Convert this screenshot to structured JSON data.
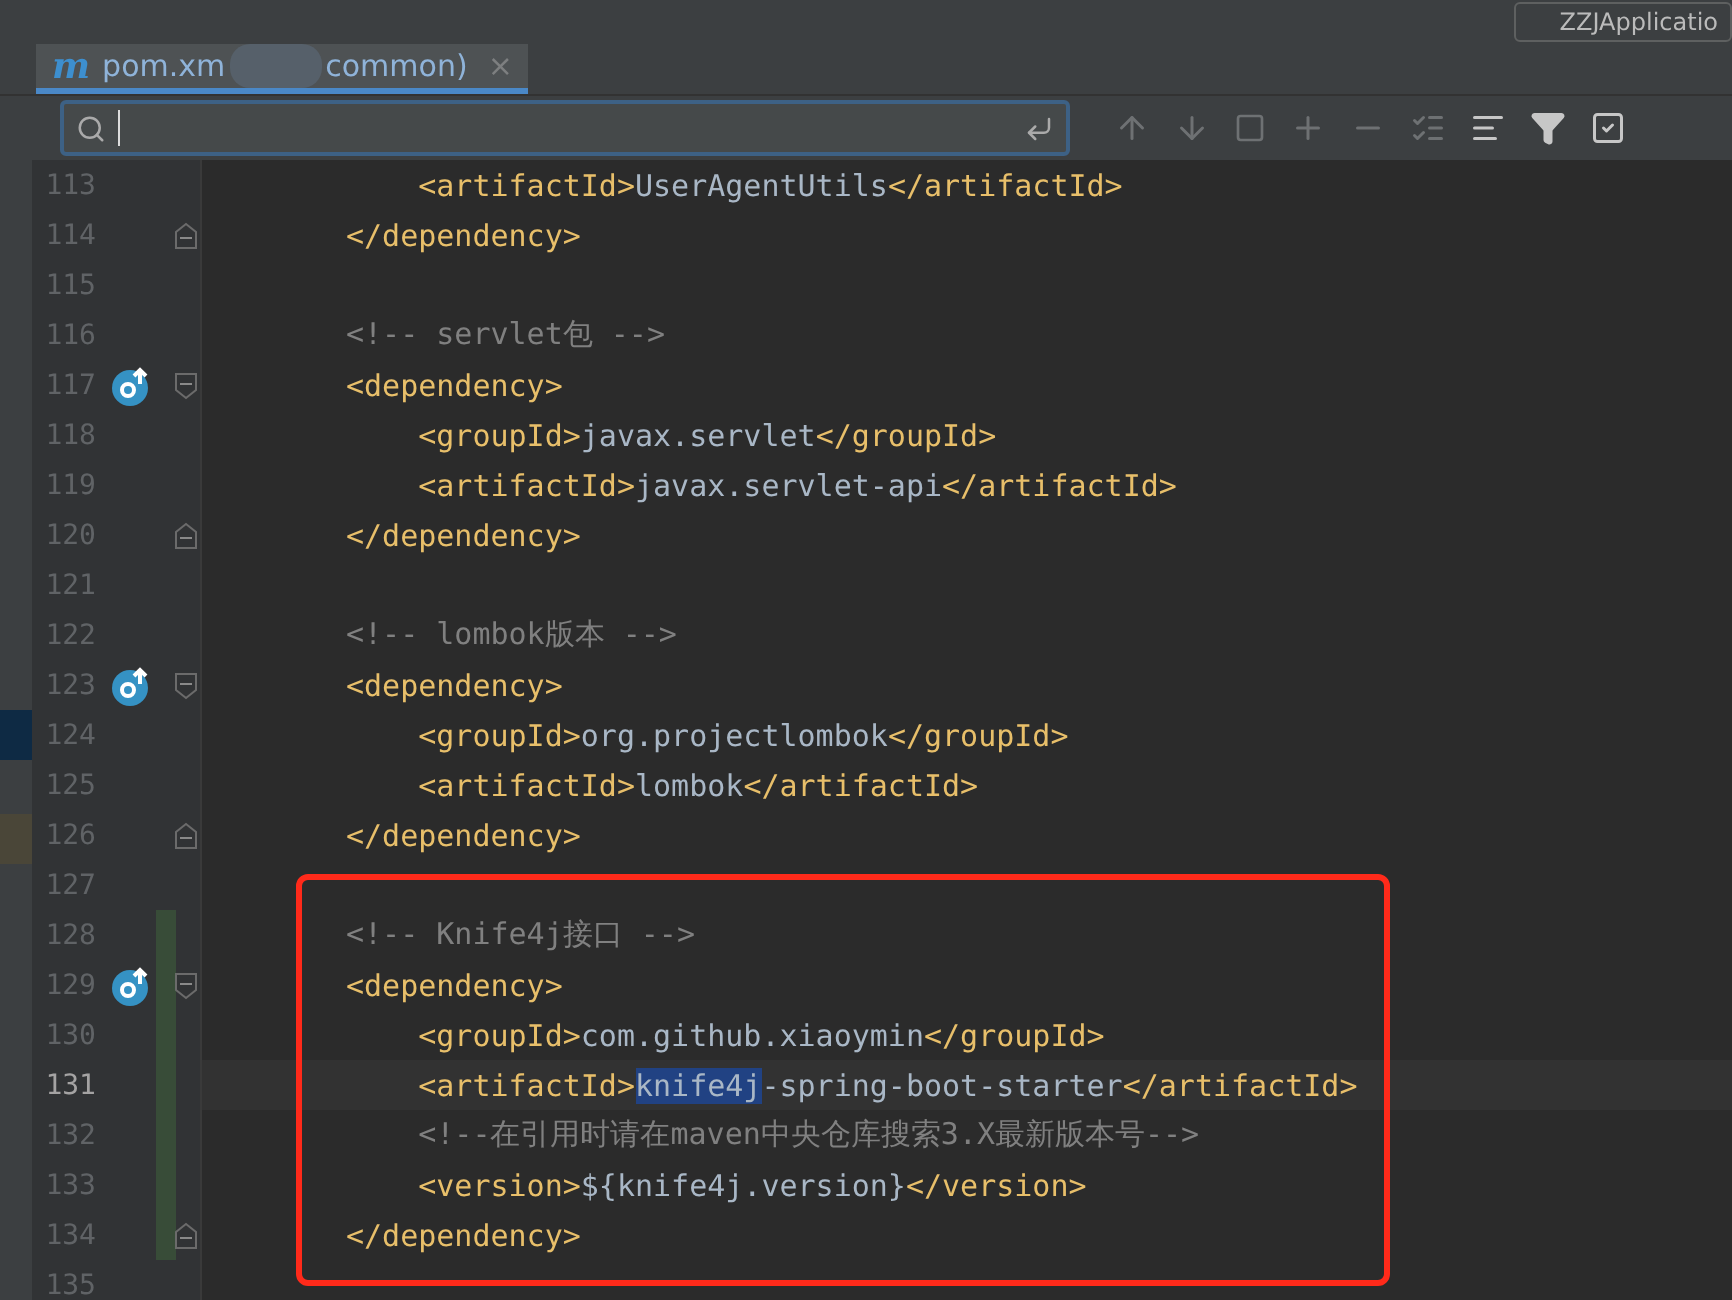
{
  "run_config": {
    "label": "ZZJApplicatio"
  },
  "tabs": [
    {
      "logo": "m",
      "label_start": "pom.xm",
      "label_end": "common)",
      "close": "×",
      "selected": true
    }
  ],
  "lines": [
    {
      "number": "113",
      "marker": false,
      "fold_start": false,
      "fold_end": false,
      "changed": false,
      "current": false,
      "parts": [
        {
          "kind": "tag",
          "text": "    <artifactId>"
        },
        {
          "kind": "text",
          "text": "UserAgentUtils"
        },
        {
          "kind": "tag",
          "text": "</artifactId>"
        }
      ]
    },
    {
      "number": "114",
      "marker": false,
      "fold_start": false,
      "fold_end": true,
      "changed": false,
      "current": false,
      "parts": [
        {
          "kind": "tag",
          "text": "</dependency>"
        }
      ]
    },
    {
      "number": "115",
      "marker": false,
      "fold_start": false,
      "fold_end": false,
      "changed": false,
      "current": false
    },
    {
      "number": "116",
      "marker": false,
      "fold_start": false,
      "fold_end": false,
      "changed": false,
      "current": false,
      "parts": [
        {
          "kind": "comment",
          "text": "<!-- servlet包 -->"
        }
      ]
    },
    {
      "number": "117",
      "marker": true,
      "fold_start": true,
      "fold_end": false,
      "changed": false,
      "current": false,
      "parts": [
        {
          "kind": "tag",
          "text": "<dependency>"
        }
      ]
    },
    {
      "number": "118",
      "marker": false,
      "fold_start": false,
      "fold_end": false,
      "changed": false,
      "current": false,
      "parts": [
        {
          "kind": "tag",
          "text": "    <groupId>"
        },
        {
          "kind": "text",
          "text": "javax.servlet"
        },
        {
          "kind": "tag",
          "text": "</groupId>"
        }
      ]
    },
    {
      "number": "119",
      "marker": false,
      "fold_start": false,
      "fold_end": false,
      "changed": false,
      "current": false,
      "parts": [
        {
          "kind": "tag",
          "text": "    <artifactId>"
        },
        {
          "kind": "text",
          "text": "javax.servlet-api"
        },
        {
          "kind": "tag",
          "text": "</artifactId>"
        }
      ]
    },
    {
      "number": "120",
      "marker": false,
      "fold_start": false,
      "fold_end": true,
      "changed": false,
      "current": false,
      "parts": [
        {
          "kind": "tag",
          "text": "</dependency>"
        }
      ]
    },
    {
      "number": "121",
      "marker": false,
      "fold_start": false,
      "fold_end": false,
      "changed": false,
      "current": false
    },
    {
      "number": "122",
      "marker": false,
      "fold_start": false,
      "fold_end": false,
      "changed": false,
      "current": false,
      "parts": [
        {
          "kind": "comment",
          "text": "<!-- lombok版本 -->"
        }
      ]
    },
    {
      "number": "123",
      "marker": true,
      "fold_start": true,
      "fold_end": false,
      "changed": false,
      "current": false,
      "parts": [
        {
          "kind": "tag",
          "text": "<dependency>"
        }
      ]
    },
    {
      "number": "124",
      "marker": false,
      "fold_start": false,
      "fold_end": false,
      "changed": false,
      "current": false,
      "parts": [
        {
          "kind": "tag",
          "text": "    <groupId>"
        },
        {
          "kind": "text",
          "text": "org.projectlombok"
        },
        {
          "kind": "tag",
          "text": "</groupId>"
        }
      ]
    },
    {
      "number": "125",
      "marker": false,
      "fold_start": false,
      "fold_end": false,
      "changed": false,
      "current": false,
      "parts": [
        {
          "kind": "tag",
          "text": "    <artifactId>"
        },
        {
          "kind": "text",
          "text": "lombok"
        },
        {
          "kind": "tag",
          "text": "</artifactId>"
        }
      ]
    },
    {
      "number": "126",
      "marker": false,
      "fold_start": false,
      "fold_end": true,
      "changed": false,
      "current": false,
      "parts": [
        {
          "kind": "tag",
          "text": "</dependency>"
        }
      ]
    },
    {
      "number": "127",
      "marker": false,
      "fold_start": false,
      "fold_end": false,
      "changed": false,
      "current": false
    },
    {
      "number": "128",
      "marker": false,
      "fold_start": false,
      "fold_end": false,
      "changed": true,
      "current": false,
      "parts": [
        {
          "kind": "comment",
          "text": "<!-- Knife4j接口 -->"
        }
      ]
    },
    {
      "number": "129",
      "marker": true,
      "fold_start": true,
      "fold_end": false,
      "changed": true,
      "current": false,
      "parts": [
        {
          "kind": "tag",
          "text": "<dependency>"
        }
      ]
    },
    {
      "number": "130",
      "marker": false,
      "fold_start": false,
      "fold_end": false,
      "changed": true,
      "current": false,
      "parts": [
        {
          "kind": "tag",
          "text": "    <groupId>"
        },
        {
          "kind": "text",
          "text": "com.github.xiaoymin"
        },
        {
          "kind": "tag",
          "text": "</groupId>"
        }
      ]
    },
    {
      "number": "131",
      "marker": false,
      "fold_start": false,
      "fold_end": false,
      "changed": true,
      "current": true,
      "parts": [
        {
          "kind": "tag",
          "text": "    <artifactId>"
        },
        {
          "kind": "text",
          "text": "knife4j",
          "selected": true
        },
        {
          "kind": "text",
          "text": "-spring-boot-starter",
          "selected": false
        },
        {
          "kind": "tag",
          "text": "</artifactId>"
        }
      ]
    },
    {
      "number": "132",
      "marker": false,
      "fold_start": false,
      "fold_end": false,
      "changed": true,
      "current": false,
      "parts": [
        {
          "kind": "comment",
          "text": "    <!--在引用时请在maven中央仓库搜索3.X最新版本号-->"
        }
      ]
    },
    {
      "number": "133",
      "marker": false,
      "fold_start": false,
      "fold_end": false,
      "changed": true,
      "current": false,
      "parts": [
        {
          "kind": "tag",
          "text": "    <version>"
        },
        {
          "kind": "text",
          "text": "${knife4j.version}"
        },
        {
          "kind": "tag",
          "text": "</version>"
        }
      ]
    },
    {
      "number": "134",
      "marker": false,
      "fold_start": false,
      "fold_end": true,
      "changed": true,
      "current": false,
      "parts": [
        {
          "kind": "tag",
          "text": "</dependency>"
        }
      ]
    },
    {
      "number": "135",
      "marker": false,
      "fold_start": false,
      "fold_end": false,
      "changed": false,
      "current": false
    }
  ]
}
